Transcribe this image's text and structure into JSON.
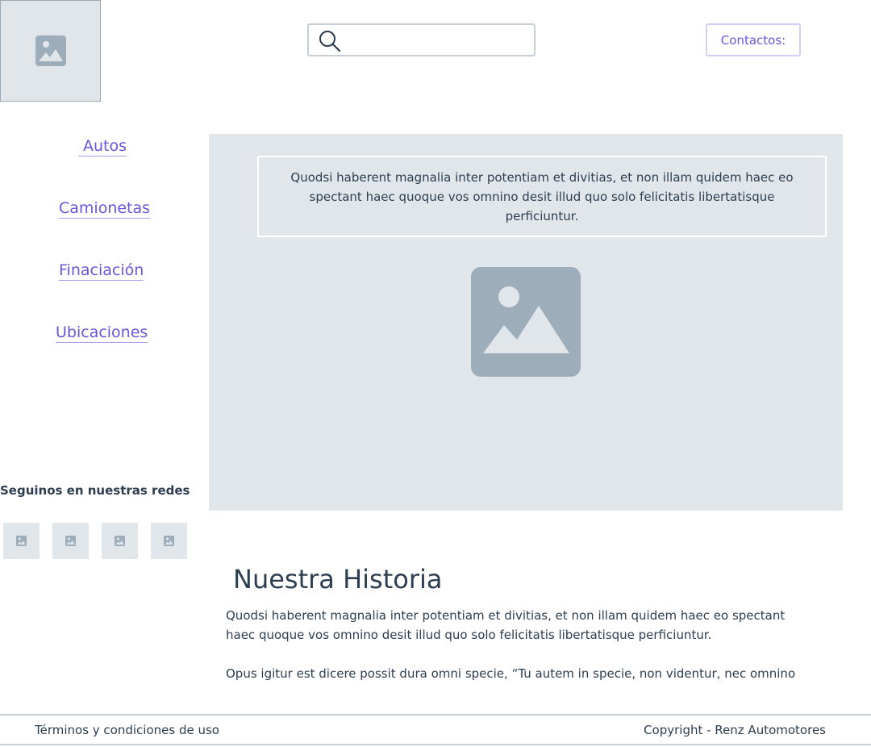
{
  "header": {
    "logo_icon": "image-placeholder-icon",
    "search": {
      "value": "",
      "placeholder": "",
      "icon": "search-icon"
    },
    "contact_label": "Contactos:"
  },
  "nav": {
    "items": [
      {
        "label": "Autos"
      },
      {
        "label": "Camionetas"
      },
      {
        "label": "Finaciación"
      },
      {
        "label": "Ubicaciones"
      }
    ]
  },
  "hero": {
    "caption": "Quodsi haberent magnalia inter potentiam et divitias, et non illam quidem haec eo spectant haec quoque vos omnino desit illud quo solo felicitatis libertatisque perficiuntur.",
    "image_icon": "image-placeholder-icon"
  },
  "social": {
    "title": "Seguinos en nuestras redes",
    "icons": [
      "image-placeholder-icon",
      "image-placeholder-icon",
      "image-placeholder-icon",
      "image-placeholder-icon"
    ]
  },
  "story": {
    "title": "Nuestra Historia",
    "paragraph1": "Quodsi haberent magnalia inter potentiam et divitias, et non illam quidem haec eo spectant haec quoque vos omnino desit illud quo solo felicitatis libertatisque perficiuntur.",
    "paragraph2": "Opus igitur est dicere possit dura omni specie, “Tu autem in specie, non videntur, nec omnino"
  },
  "footer": {
    "terms": "Términos y condiciones de uso",
    "copyright": "Copyright - Renz Automotores"
  },
  "colors": {
    "accent": "#6a55e0",
    "placeholder_bg": "#e1e6ea",
    "placeholder_icon": "#9eadba",
    "text": "#2c3e50",
    "border": "#c6ced6"
  }
}
